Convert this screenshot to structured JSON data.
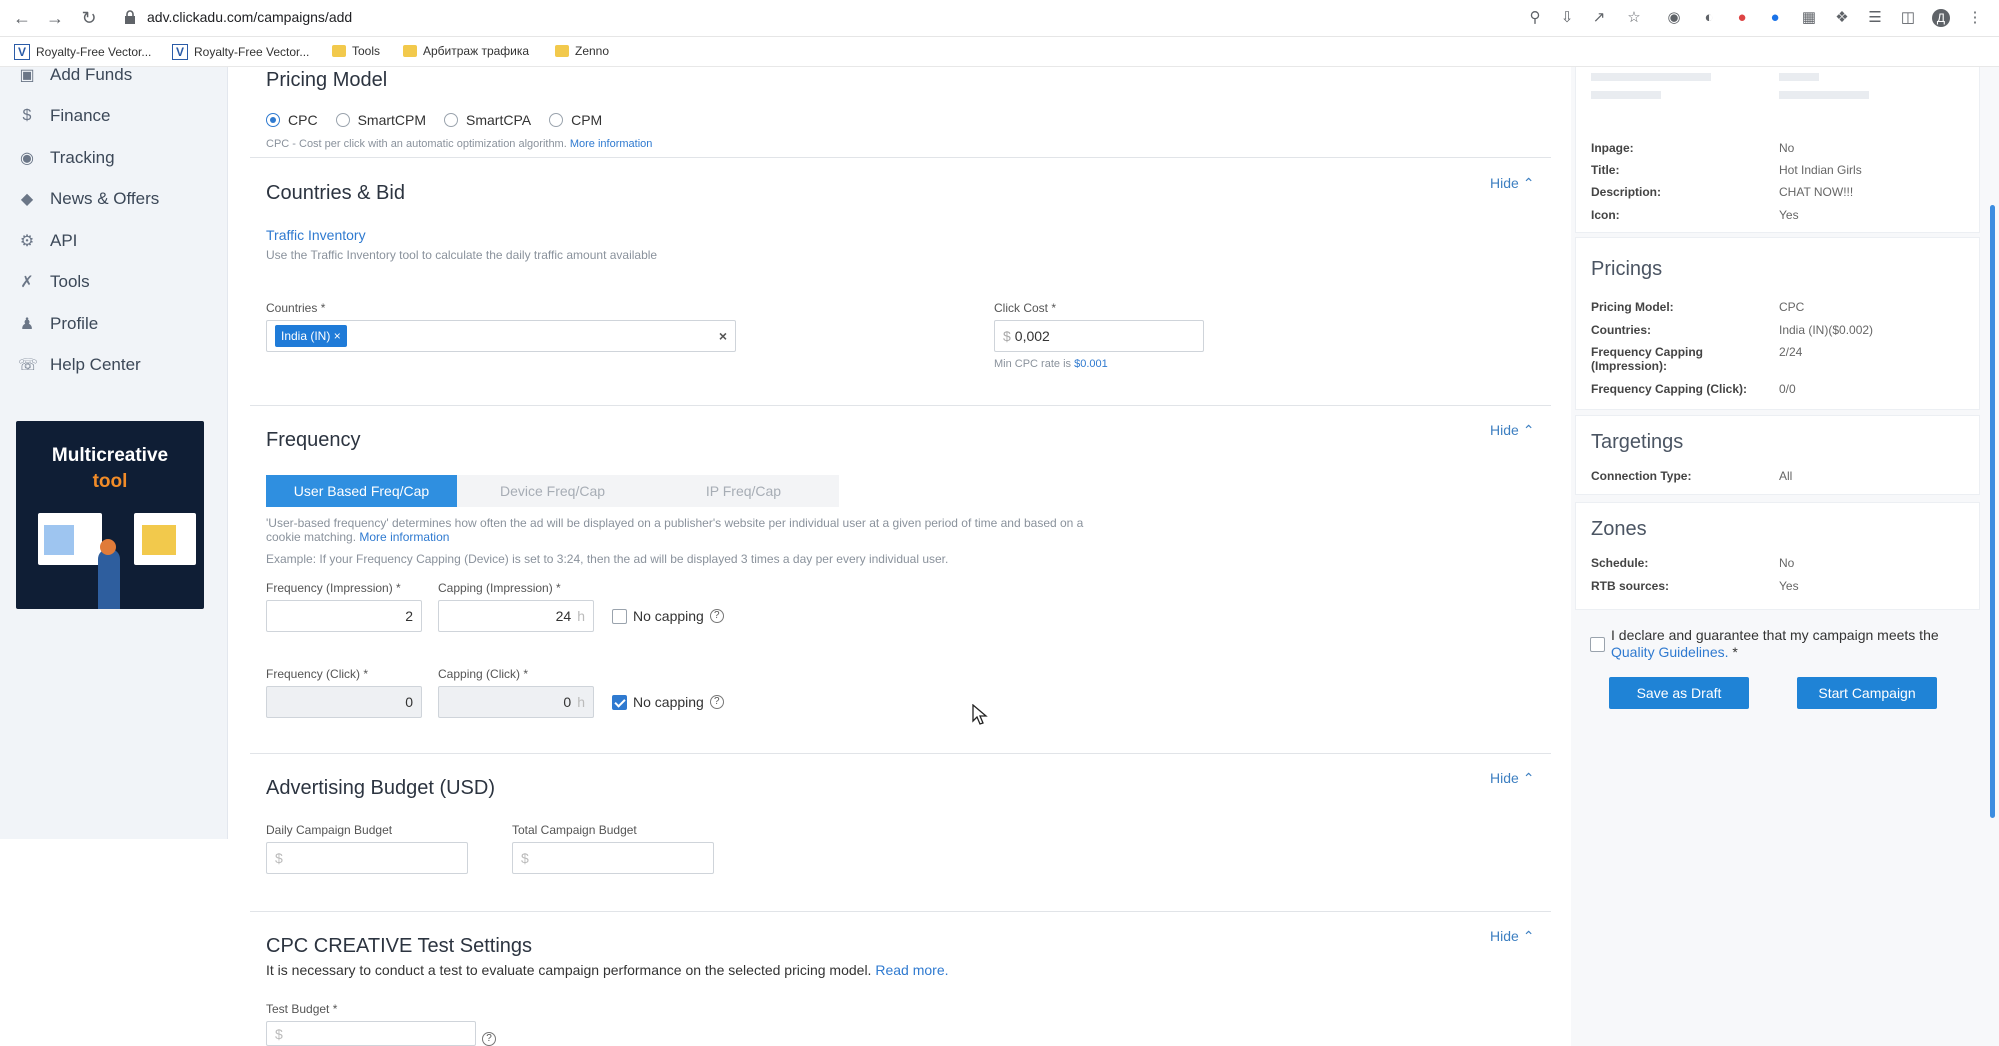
{
  "browser": {
    "url": "adv.clickadu.com/campaigns/add",
    "bookmarks": [
      "Royalty-Free Vector...",
      "Royalty-Free Vector...",
      "Tools",
      "Арбитраж трафика",
      "Zenno"
    ]
  },
  "sidebar": {
    "items": [
      {
        "label": "Add Funds",
        "icon": "wallet-icon"
      },
      {
        "label": "Finance",
        "icon": "dollar-icon"
      },
      {
        "label": "Tracking",
        "icon": "eye-icon"
      },
      {
        "label": "News & Offers",
        "icon": "diamond-icon"
      },
      {
        "label": "API",
        "icon": "gears-icon"
      },
      {
        "label": "Tools",
        "icon": "wrench-icon"
      },
      {
        "label": "Profile",
        "icon": "user-icon"
      },
      {
        "label": "Help Center",
        "icon": "headset-icon"
      }
    ],
    "promo": {
      "title": "Multicreative",
      "subtitle": "tool"
    }
  },
  "pricing": {
    "title": "Pricing Model",
    "options": [
      "CPC",
      "SmartCPM",
      "SmartCPA",
      "CPM"
    ],
    "selected": "CPC",
    "help": "CPC - Cost per click with an automatic optimization algorithm.",
    "more": "More information"
  },
  "countries": {
    "title": "Countries & Bid",
    "hide": "Hide",
    "inventory_link": "Traffic Inventory",
    "inventory_help": "Use the Traffic Inventory tool to calculate the daily traffic amount available",
    "countries_label": "Countries",
    "country_tag": "India (IN)",
    "click_cost_label": "Click Cost",
    "currency": "$",
    "click_cost": "0,002",
    "min_cpc_prefix": "Min CPC rate is",
    "min_cpc_value": "$0.001"
  },
  "frequency": {
    "title": "Frequency",
    "hide": "Hide",
    "tabs": [
      "User Based Freq/Cap",
      "Device Freq/Cap",
      "IP Freq/Cap"
    ],
    "active_tab": "User Based Freq/Cap",
    "desc_line1": "'User-based frequency' determines how often the ad will be displayed on a publisher's website per individual user at a given period of time and based on a",
    "desc_line2": "cookie matching.",
    "desc_more": "More information",
    "example": "Example: If your Frequency Capping (Device) is set to 3:24, then the ad will be displayed 3 times a day per every individual user.",
    "freq_imp_label": "Frequency (Impression)",
    "freq_imp_value": "2",
    "cap_imp_label": "Capping (Impression)",
    "cap_imp_value": "24",
    "unit": "h",
    "freq_click_label": "Frequency (Click)",
    "freq_click_value": "0",
    "cap_click_label": "Capping (Click)",
    "cap_click_value": "0",
    "no_capping": "No capping",
    "no_capping_imp_checked": false,
    "no_capping_click_checked": true
  },
  "budget": {
    "title": "Advertising Budget (USD)",
    "hide": "Hide",
    "daily_label": "Daily Campaign Budget",
    "total_label": "Total Campaign Budget",
    "placeholder": "$"
  },
  "test": {
    "title": "CPC CREATIVE Test Settings",
    "hide": "Hide",
    "desc": "It is necessary to conduct a test to evaluate campaign performance on the selected pricing model.",
    "read_more": "Read more.",
    "budget_label": "Test Budget",
    "placeholder": "$"
  },
  "summary": {
    "creative": [
      {
        "k": "Inpage:",
        "v": "No"
      },
      {
        "k": "Title:",
        "v": "Hot Indian Girls"
      },
      {
        "k": "Description:",
        "v": "CHAT NOW!!!"
      },
      {
        "k": "Icon:",
        "v": "Yes"
      }
    ],
    "pricings": {
      "title": "Pricings",
      "rows": [
        {
          "k": "Pricing Model:",
          "v": "CPC"
        },
        {
          "k": "Countries:",
          "v": "India (IN)($0.002)"
        },
        {
          "k": "Frequency Capping",
          "k2": "(Impression):",
          "v": "2/24"
        },
        {
          "k": "Frequency Capping (Click):",
          "v": "0/0"
        }
      ]
    },
    "targetings": {
      "title": "Targetings",
      "rows": [
        {
          "k": "Connection Type:",
          "v": "All"
        }
      ]
    },
    "zones": {
      "title": "Zones",
      "rows": [
        {
          "k": "Schedule:",
          "v": "No"
        },
        {
          "k": "RTB sources:",
          "v": "Yes"
        }
      ]
    },
    "declare": "I declare and guarantee that my campaign meets the",
    "declare_link": "Quality Guidelines.",
    "required": "*",
    "save_draft": "Save as Draft",
    "start": "Start Campaign"
  },
  "colors": {
    "accent": "#1f83d6",
    "link": "#2f7ad0",
    "sidebar_bg": "#f1f4f8"
  }
}
